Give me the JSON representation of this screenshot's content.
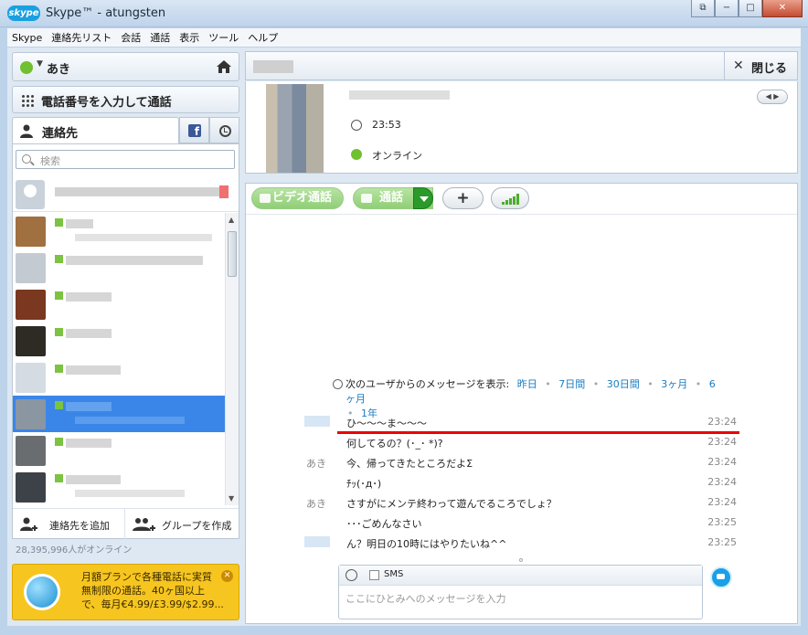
{
  "window": {
    "logo": "skype",
    "title": "Skype™ - atungsten",
    "restore": "⧉",
    "minimize": "−",
    "maximize": "□",
    "close": "✕"
  },
  "menu": [
    "Skype",
    "連絡先リスト",
    "会話",
    "通話",
    "表示",
    "ツール",
    "ヘルプ"
  ],
  "status": {
    "name": "あき",
    "color": "#6fc12f"
  },
  "dial": {
    "label": "電話番号を入力して通話"
  },
  "tabs": {
    "contacts": "連絡先"
  },
  "search": {
    "placeholder": "検索"
  },
  "actions": {
    "add_contact": "連絡先を追加",
    "create_group": "グループを作成"
  },
  "online_count": "28,395,996人がオンライン",
  "ad": {
    "line1": "月額プランで各種電話に実質",
    "line2": "無制限の通話。40ヶ国以上",
    "line3": "で、毎月€4.99/£3.99/$2.99..."
  },
  "chat_header": {
    "close_label": "閉じる"
  },
  "profile": {
    "local_time": "23:53",
    "status": "オンライン"
  },
  "toolbar": {
    "video_call": "ビデオ通話",
    "call": "通話"
  },
  "history": {
    "label": "次のユーザからのメッセージを表示:",
    "links": [
      "昨日",
      "7日間",
      "30日間",
      "3ヶ月",
      "6ヶ月",
      "1年"
    ]
  },
  "messages": [
    {
      "sender": "",
      "text": "ひ〜〜〜ま〜〜〜",
      "time": "23:24"
    },
    {
      "sender": "",
      "text": "何してるの？(･_･ *)?",
      "time": "23:24"
    },
    {
      "sender": "あき",
      "text": "今、帰ってきたところだよΣ",
      "time": "23:24"
    },
    {
      "sender": "",
      "text": "ﾁｯ(･д･)",
      "time": "23:24"
    },
    {
      "sender": "あき",
      "text": "さすがにメンテ終わって遊んでるころでしょ？",
      "time": "23:24"
    },
    {
      "sender": "",
      "text": "･･･ごめんなさい",
      "time": "23:25"
    },
    {
      "sender": "",
      "text": "ん？明日の10時にはやりたいね^^",
      "time": "23:25"
    }
  ],
  "composer": {
    "sms_label": "SMS",
    "placeholder": "ここにひとみへのメッセージを入力"
  }
}
